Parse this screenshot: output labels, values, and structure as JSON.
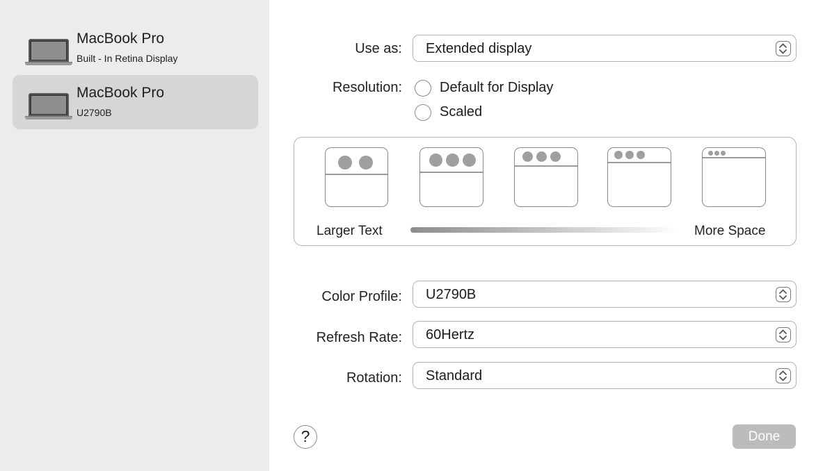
{
  "sidebar": {
    "devices": [
      {
        "name": "MacBook Pro",
        "subtitle": "Built - In Retina Display",
        "selected": false
      },
      {
        "name": "MacBook Pro",
        "subtitle": "U2790B",
        "selected": true
      }
    ]
  },
  "settings": {
    "use_as": {
      "label": "Use as:",
      "value": "Extended display"
    },
    "resolution": {
      "label": "Resolution:",
      "options": [
        "Default for Display",
        "Scaled"
      ]
    },
    "scale": {
      "left_label": "Larger Text",
      "right_label": "More Space"
    },
    "color_profile": {
      "label": "Color Profile:",
      "value": "U2790B"
    },
    "refresh_rate": {
      "label": "Refresh Rate:",
      "value": "60Hertz"
    },
    "rotation": {
      "label": "Rotation:",
      "value": "Standard"
    }
  },
  "footer": {
    "help_label": "?",
    "done_label": "Done"
  },
  "icons": {
    "device": "laptop-icon",
    "stepper": "stepper-arrows-icon",
    "help": "help-icon"
  }
}
